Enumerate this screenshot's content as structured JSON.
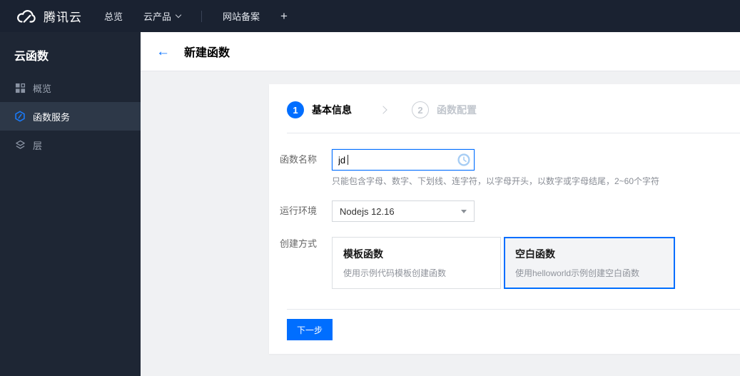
{
  "navbar": {
    "brand": "腾讯云",
    "items": [
      {
        "label": "总览"
      },
      {
        "label": "云产品"
      },
      {
        "label": "网站备案"
      },
      {
        "label": "+"
      }
    ]
  },
  "sidebar": {
    "title": "云函数",
    "items": [
      {
        "label": "概览",
        "icon": "grid-icon",
        "active": false
      },
      {
        "label": "函数服务",
        "icon": "function-service-icon",
        "active": true
      },
      {
        "label": "层",
        "icon": "layers-icon",
        "active": false
      }
    ]
  },
  "header": {
    "title": "新建函数"
  },
  "icons": {
    "back_arrow": "←",
    "brand_logo": "tencent-cloud-logo-icon",
    "name_field": "loading-clock-icon"
  },
  "wizard": {
    "steps": [
      {
        "number": "1",
        "label": "基本信息",
        "state": "active"
      },
      {
        "number": "2",
        "label": "函数配置",
        "state": "pending"
      }
    ]
  },
  "form": {
    "name": {
      "label": "函数名称",
      "value": "jd",
      "hint": "只能包含字母、数字、下划线、连字符，以字母开头，以数字或字母结尾，2~60个字符"
    },
    "runtime": {
      "label": "运行环境",
      "value": "Nodejs 12.16"
    },
    "method": {
      "label": "创建方式",
      "options": [
        {
          "title": "模板函数",
          "desc": "使用示例代码模板创建函数",
          "selected": false
        },
        {
          "title": "空白函数",
          "desc": "使用helloworld示例创建空白函数",
          "selected": true
        }
      ]
    }
  },
  "actions": {
    "next": "下一步"
  },
  "colors": {
    "accent": "#006eff",
    "navbar_bg": "#1a2231",
    "sidebar_bg": "#1e2634",
    "sidebar_active_bg": "#2d3848",
    "content_bg": "#f0f1f3",
    "selected_card_bg": "#f3f4f6",
    "pending_step": "#c1c6cd"
  }
}
